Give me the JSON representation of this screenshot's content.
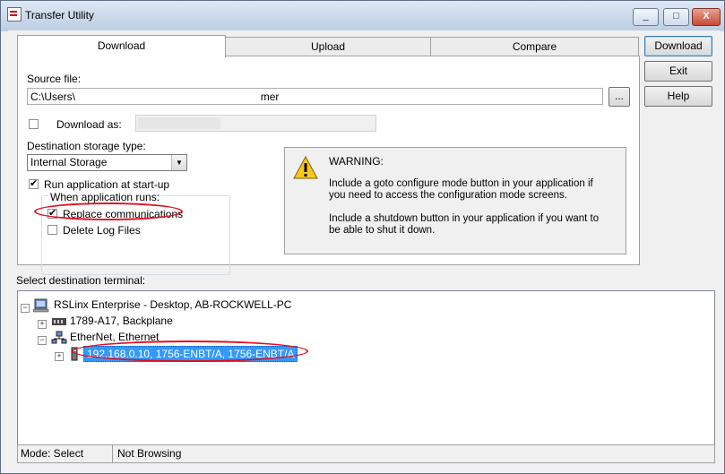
{
  "window": {
    "title": "Transfer Utility",
    "minimize": "_",
    "maximize": "□",
    "close": "X"
  },
  "tabs": [
    {
      "label": "Download",
      "active": true
    },
    {
      "label": "Upload",
      "active": false
    },
    {
      "label": "Compare",
      "active": false
    }
  ],
  "side_buttons": {
    "download": "Download",
    "exit": "Exit",
    "help": "Help"
  },
  "download_panel": {
    "source_file_label": "Source file:",
    "source_file_value": "C:\\Users\\                                                              mer",
    "browse_label": "...",
    "download_as_label": "Download as:",
    "download_as_checked": false,
    "destination_storage_label": "Destination storage type:",
    "destination_storage_value": "Internal Storage",
    "run_at_startup_label": "Run application at start-up",
    "run_at_startup_checked": true,
    "when_runs_label": "When application runs:",
    "replace_comm_label": "Replace communications",
    "replace_comm_checked": true,
    "delete_logs_label": "Delete Log Files",
    "delete_logs_checked": false,
    "warning_title": "WARNING:",
    "warning_text_1": "Include a goto configure mode button in your application if",
    "warning_text_2": "you need to access the configuration mode screens.",
    "warning_text_3": "Include a shutdown button in your application if you want to",
    "warning_text_4": "be able to shut it down."
  },
  "destination": {
    "label": "Select destination terminal:",
    "tree": {
      "root": "RSLinx Enterprise - Desktop, AB-ROCKWELL-PC",
      "backplane": "1789-A17, Backplane",
      "ethernet": "EtherNet, Ethernet",
      "device": "192.168.0.10, 1756-ENBT/A, 1756-ENBT/A"
    }
  },
  "status": {
    "mode": "Mode: Select",
    "browsing": "Not Browsing"
  },
  "colors": {
    "selection": "#3399ff",
    "highlight_oval": "#e01020"
  }
}
